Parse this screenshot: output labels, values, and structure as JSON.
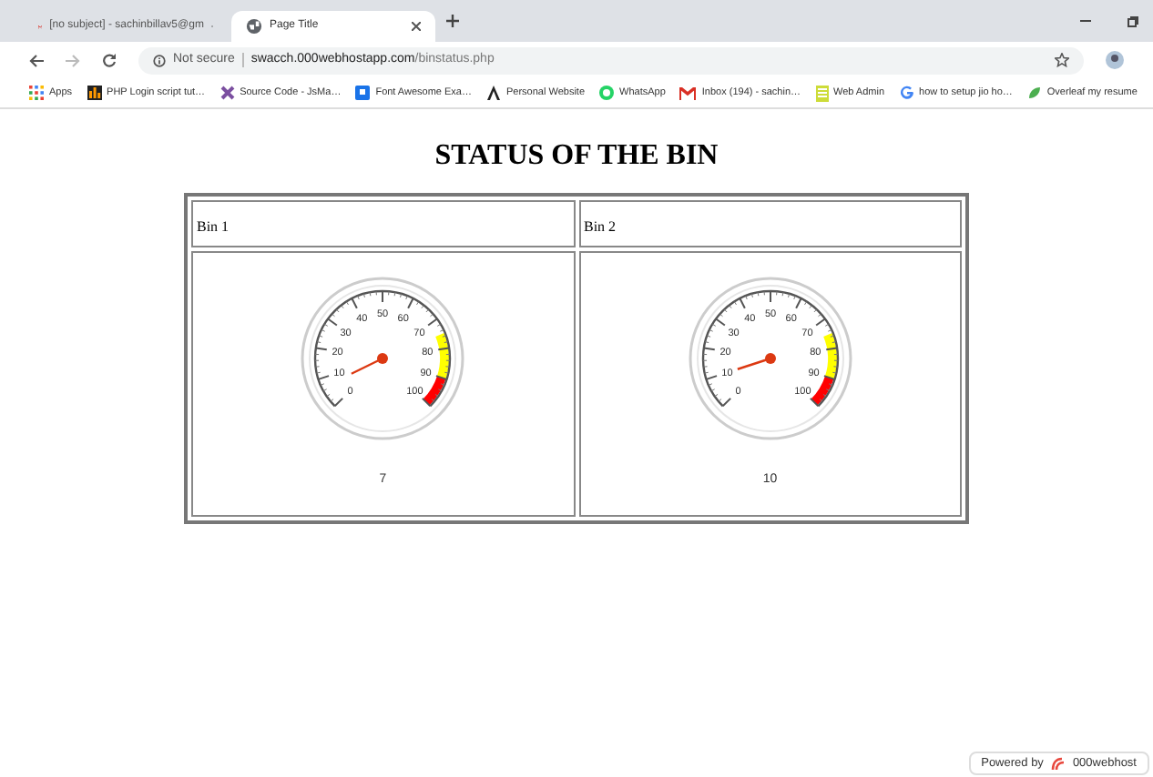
{
  "browser": {
    "tabs": [
      {
        "title": "[no subject] - sachinbillav5@gm",
        "selected": false
      },
      {
        "title": "Page Title",
        "selected": true
      }
    ],
    "security": "Not secure",
    "url_host": "swacch.000webhostapp.com",
    "url_path": "/binstatus.php",
    "bookmarks": [
      {
        "label": "Apps"
      },
      {
        "label": "PHP Login script tut…"
      },
      {
        "label": "Source Code - JsMa…"
      },
      {
        "label": "Font Awesome Exa…"
      },
      {
        "label": "Personal Website"
      },
      {
        "label": "WhatsApp"
      },
      {
        "label": "Inbox (194) - sachin…"
      },
      {
        "label": "Web Admin"
      },
      {
        "label": "how to setup jio ho…"
      },
      {
        "label": "Overleaf my resume"
      }
    ]
  },
  "page": {
    "heading": "STATUS OF THE BIN",
    "table": {
      "columns": [
        "Bin 1",
        "Bin 2"
      ],
      "gauges": [
        {
          "reading": "7",
          "scale_labels": [
            "0",
            "10",
            "20",
            "30",
            "40",
            "50",
            "60",
            "70",
            "80",
            "90",
            "100"
          ]
        },
        {
          "reading": "10",
          "scale_labels": [
            "0",
            "10",
            "20",
            "30",
            "40",
            "50",
            "60",
            "70",
            "80",
            "90",
            "100"
          ]
        }
      ]
    }
  },
  "footer": {
    "prefix": "Powered by",
    "brand": "000webhost"
  }
}
